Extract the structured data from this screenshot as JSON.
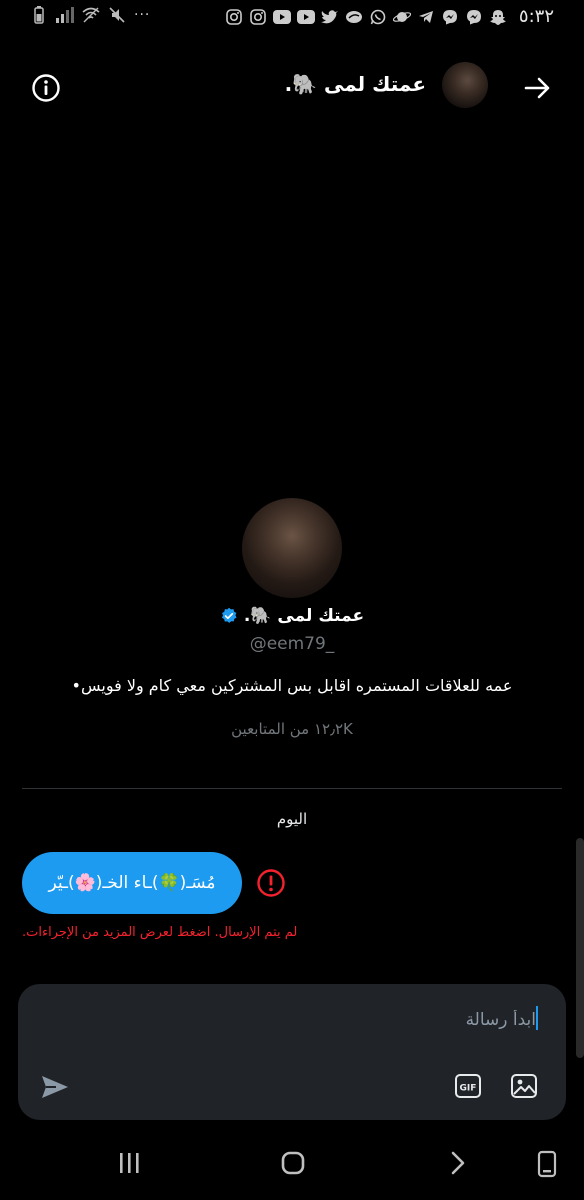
{
  "status_bar": {
    "time": "٥:٣٢",
    "left_icons": [
      "battery-icon",
      "signal-icon",
      "wifi-icon",
      "mute-icon",
      "more-dots-icon"
    ],
    "right_icons": [
      "instagram-icon",
      "instagram-icon",
      "youtube-icon",
      "youtube-icon",
      "twitter-icon",
      "pin-icon",
      "whatsapp-icon",
      "planet-icon",
      "telegram-icon",
      "messenger-icon",
      "messenger-icon",
      "snapchat-icon"
    ],
    "more": "···"
  },
  "header": {
    "name": "عمتك لمى 🐘.",
    "back_icon": "arrow-right-icon",
    "info_icon": "info-icon"
  },
  "profile": {
    "name": "عمتك لمى 🐘.",
    "verified": true,
    "handle": "@eem79_",
    "bio": "عمه للعلاقات المستمره اقابل بس المشتركين معي كام ولا فويس•",
    "followers": "١٢٫٢K من المتابعين"
  },
  "conversation": {
    "day_label": "اليوم",
    "message_text": "مُسَـ(🍀)ـاء الخـ(🌸)ـيّر",
    "error_text": "لم يتم الإرسال. اضغط لعرض المزيد من الإجراءات."
  },
  "composer": {
    "placeholder": "ابدأ رسالة",
    "gif_label": "GIF"
  },
  "colors": {
    "accent": "#1d9bf0",
    "error": "#f4212e",
    "muted": "#71767b",
    "composer_bg": "#202327"
  }
}
